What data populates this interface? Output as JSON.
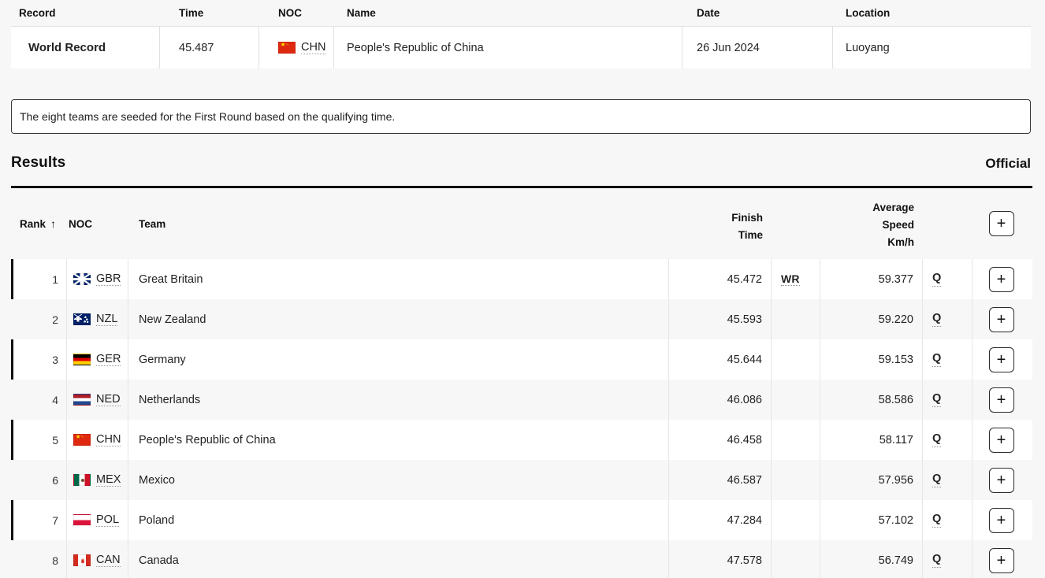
{
  "record_table": {
    "headers": [
      "Record",
      "Time",
      "NOC",
      "Name",
      "Date",
      "Location"
    ],
    "rows": [
      {
        "record": "World Record",
        "time": "45.487",
        "noc": "CHN",
        "flag": "flag-chn",
        "name": "People's Republic of China",
        "date": "26 Jun 2024",
        "location": "Luoyang"
      }
    ]
  },
  "note": {
    "text": "The eight teams are seeded for the First Round based on the qualifying time."
  },
  "results_section": {
    "title": "Results",
    "status": "Official",
    "expand_all_icon": "plus-icon",
    "headers": {
      "rank": "Rank",
      "sort_arrow": "↑",
      "noc": "NOC",
      "team": "Team",
      "finish_time_line1": "Finish",
      "finish_time_line2": "Time",
      "avg_speed_line1": "Average",
      "avg_speed_line2": "Speed",
      "avg_speed_line3": "Km/h",
      "expand": "+"
    },
    "rows": [
      {
        "rank": "1",
        "noc": "GBR",
        "flag": "flag-gbr",
        "team": "Great Britain",
        "finish_time": "45.472",
        "record_mark": "WR",
        "avg_speed": "59.377",
        "qualify": "Q",
        "expand": "+"
      },
      {
        "rank": "2",
        "noc": "NZL",
        "flag": "flag-nzl",
        "team": "New Zealand",
        "finish_time": "45.593",
        "record_mark": "",
        "avg_speed": "59.220",
        "qualify": "Q",
        "expand": "+"
      },
      {
        "rank": "3",
        "noc": "GER",
        "flag": "flag-ger",
        "team": "Germany",
        "finish_time": "45.644",
        "record_mark": "",
        "avg_speed": "59.153",
        "qualify": "Q",
        "expand": "+"
      },
      {
        "rank": "4",
        "noc": "NED",
        "flag": "flag-ned",
        "team": "Netherlands",
        "finish_time": "46.086",
        "record_mark": "",
        "avg_speed": "58.586",
        "qualify": "Q",
        "expand": "+"
      },
      {
        "rank": "5",
        "noc": "CHN",
        "flag": "flag-chn",
        "team": "People's Republic of China",
        "finish_time": "46.458",
        "record_mark": "",
        "avg_speed": "58.117",
        "qualify": "Q",
        "expand": "+"
      },
      {
        "rank": "6",
        "noc": "MEX",
        "flag": "flag-mex",
        "team": "Mexico",
        "finish_time": "46.587",
        "record_mark": "",
        "avg_speed": "57.956",
        "qualify": "Q",
        "expand": "+"
      },
      {
        "rank": "7",
        "noc": "POL",
        "flag": "flag-pol",
        "team": "Poland",
        "finish_time": "47.284",
        "record_mark": "",
        "avg_speed": "57.102",
        "qualify": "Q",
        "expand": "+"
      },
      {
        "rank": "8",
        "noc": "CAN",
        "flag": "flag-can",
        "team": "Canada",
        "finish_time": "47.578",
        "record_mark": "",
        "avg_speed": "56.749",
        "qualify": "Q",
        "expand": "+"
      }
    ]
  },
  "colors": {
    "page_background": "#f7f7f7",
    "row_background": "#ffffff",
    "accent_bar": "#111111",
    "text": "#222222",
    "divider": "#e6e6e6"
  }
}
